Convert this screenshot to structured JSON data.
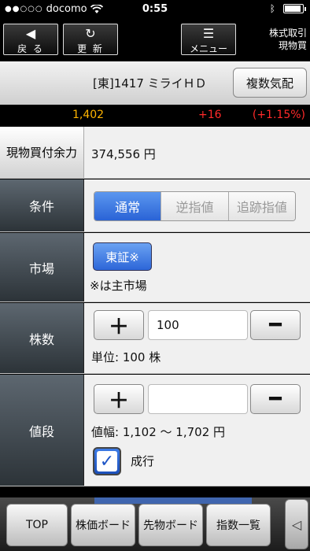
{
  "status": {
    "dots": "●●○○○",
    "carrier": "docomo",
    "time": "0:55"
  },
  "toolbar": {
    "back_label": "戻 る",
    "refresh_label": "更 新",
    "menu_label": "メニュー",
    "info_line1": "株式取引",
    "info_line2": "現物買"
  },
  "stock": {
    "name": "[東]1417 ミライＨＤ",
    "multi_quote_label": "複数気配",
    "price": "1,402",
    "change": "+16",
    "change_pct": "(+1.15%)"
  },
  "form": {
    "buying_power_label": "現物買付余力",
    "buying_power_value": "374,556 円",
    "condition_label": "条件",
    "condition_options": [
      "通常",
      "逆指値",
      "追跡指値"
    ],
    "condition_selected": "通常",
    "market_label": "市場",
    "market_button": "東証※",
    "market_note": "※は主市場",
    "shares_label": "株数",
    "shares_value": "100",
    "shares_unit": "単位: 100 株",
    "price_label": "値段",
    "price_value": "",
    "price_range": "値幅: 1,102 ～ 1,702 円",
    "market_order_label": "成行",
    "market_order_checked": true,
    "plus_label": "＋",
    "minus_label": "━"
  },
  "tabs": [
    "TOP",
    "株価ボード",
    "先物ボード",
    "指数一覧"
  ],
  "more_label": "◁",
  "colors": {
    "accent": "#2a63d6",
    "price": "#ffb400",
    "up": "#ff2a2a"
  }
}
